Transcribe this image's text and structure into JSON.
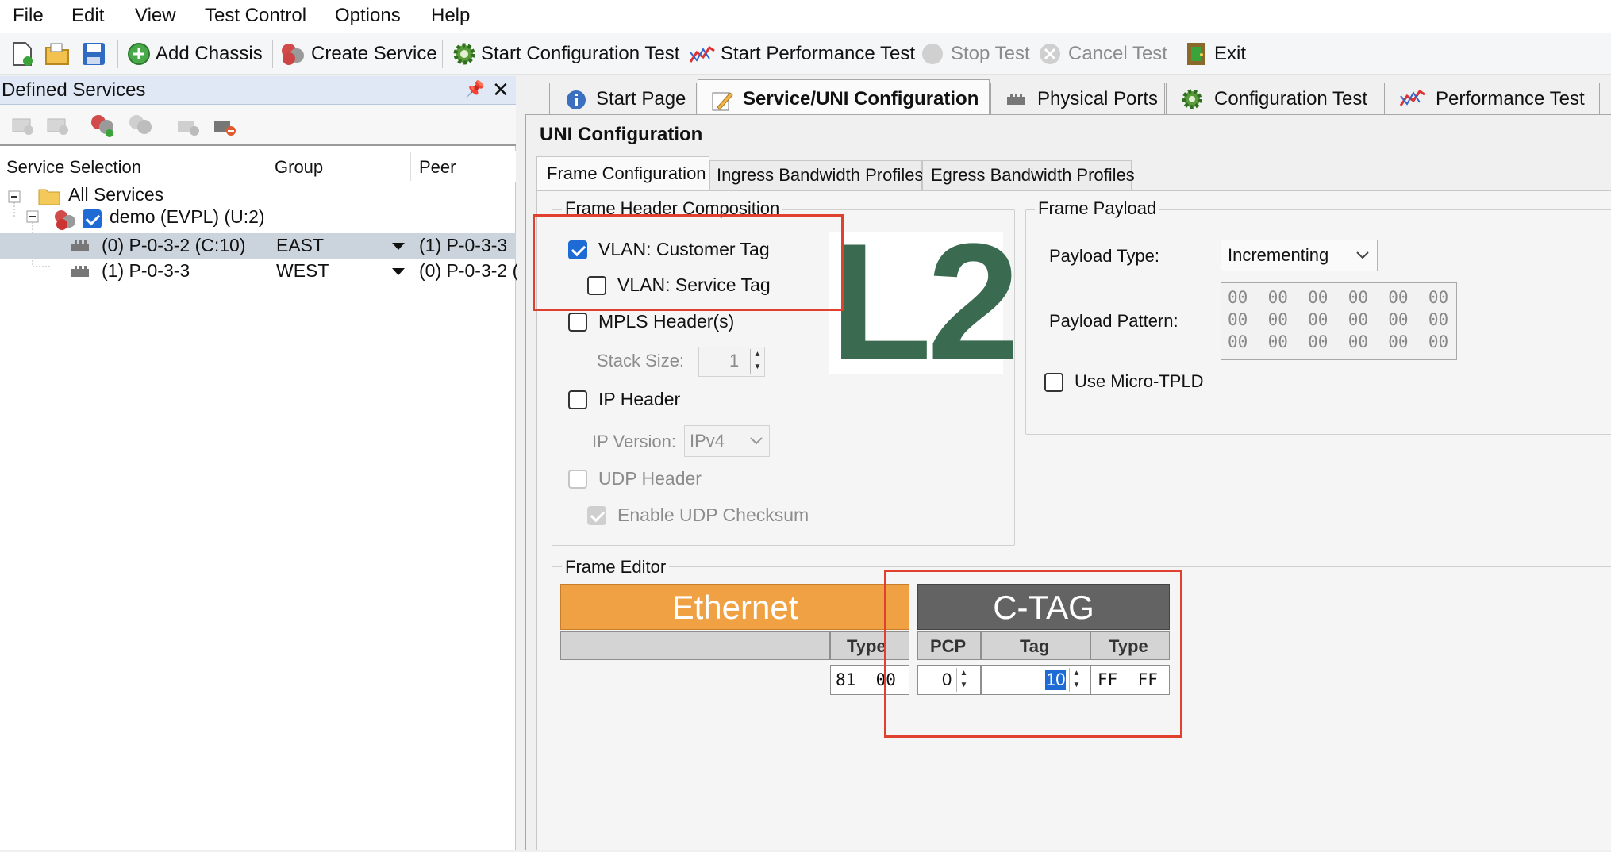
{
  "menu": [
    "File",
    "Edit",
    "View",
    "Test Control",
    "Options",
    "Help"
  ],
  "toolbar": {
    "add_chassis": "Add Chassis",
    "create_service": "Create Service",
    "start_config_test": "Start Configuration Test",
    "start_perf_test": "Start Performance Test",
    "stop_test": "Stop Test",
    "cancel_test": "Cancel Test",
    "exit": "Exit"
  },
  "left_panel": {
    "title": "Defined Services",
    "pin_glyph": "📌",
    "close_glyph": "✕",
    "columns": [
      "Service Selection",
      "Group",
      "Peer"
    ],
    "tree": {
      "root": "All Services",
      "service": "demo (EVPL) (U:2)",
      "ports": [
        {
          "name": "(0) P-0-3-2 (C:10)",
          "group": "EAST",
          "peer": "(1) P-0-3-3"
        },
        {
          "name": "(1) P-0-3-3",
          "group": "WEST",
          "peer": "(0) P-0-3-2 ("
        }
      ]
    }
  },
  "main_tabs": [
    "Start Page",
    "Service/UNI Configuration",
    "Physical Ports",
    "Configuration Test",
    "Performance Test"
  ],
  "uni_title": "UNI Configuration",
  "sub_tabs": [
    "Frame Configuration",
    "Ingress Bandwidth Profiles",
    "Egress Bandwidth Profiles"
  ],
  "frame_header": {
    "title": "Frame Header Composition",
    "vlan_customer": "VLAN: Customer Tag",
    "vlan_service": "VLAN: Service Tag",
    "mpls": "MPLS Header(s)",
    "stack_size_label": "Stack Size:",
    "stack_size": "1",
    "ip_header": "IP Header",
    "ip_version_label": "IP Version:",
    "ip_version": "IPv4",
    "udp_header": "UDP Header",
    "udp_checksum": "Enable UDP Checksum"
  },
  "overlay_label": "L2",
  "frame_payload": {
    "title": "Frame Payload",
    "payload_type_label": "Payload Type:",
    "payload_type": "Incrementing",
    "payload_pattern_label": "Payload Pattern:",
    "pattern_rows": [
      "00  00  00  00  00  00",
      "00  00  00  00  00  00",
      "00  00  00  00  00  00"
    ],
    "micro_tpld": "Use Micro-TPLD"
  },
  "frame_editor": {
    "title": "Frame Editor",
    "ethernet": {
      "name": "Ethernet",
      "type_col": "Type",
      "type_value": "81  00"
    },
    "ctag": {
      "name": "C-TAG",
      "pcp_col": "PCP",
      "tag_col": "Tag",
      "type_col": "Type",
      "pcp_value": "0",
      "tag_value": "10",
      "type_value": "FF  FF"
    }
  },
  "colors": {
    "ethernet": "#f0a143",
    "ctag": "#636363",
    "l2": "#3a6a4f",
    "highlight": "#e0412f",
    "accent": "#1e6bd6"
  }
}
